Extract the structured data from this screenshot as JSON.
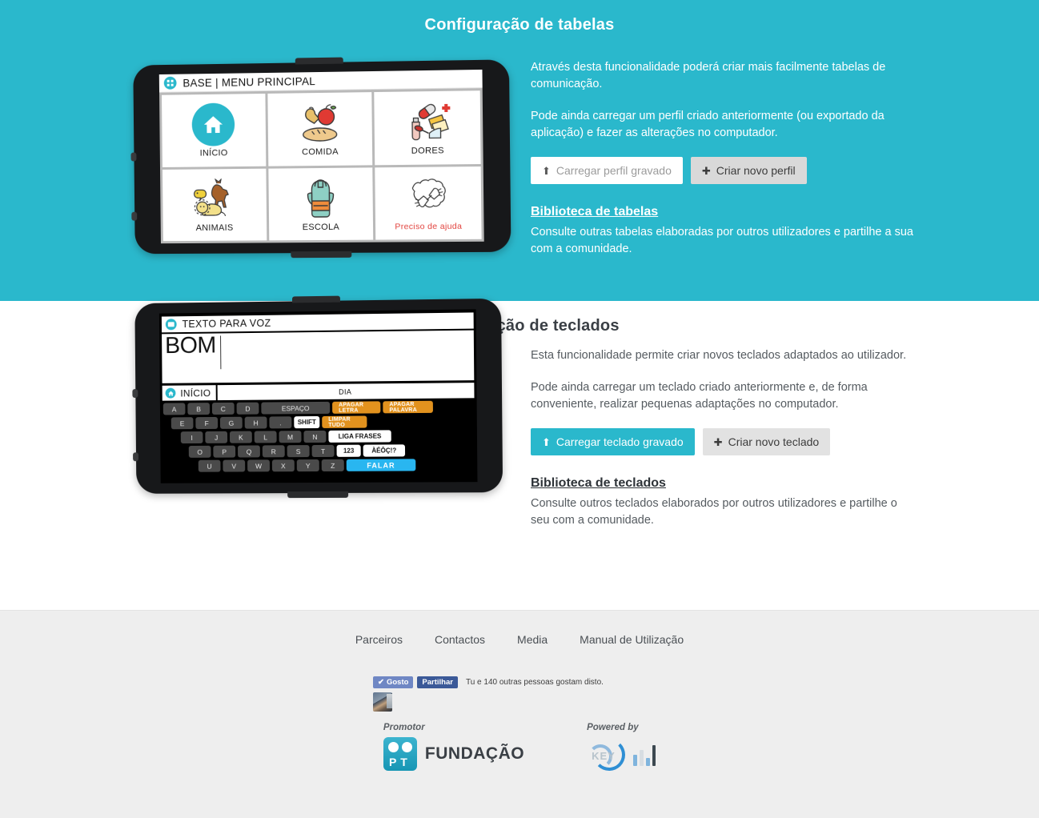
{
  "sections": {
    "tables": {
      "title": "Configuração de tabelas",
      "paragraphs": [
        "Através desta funcionalidade poderá criar mais facilmente tabelas de comunicação.",
        "Pode ainda carregar um perfil criado anteriormente (ou exportado da aplicação) e fazer as alterações no computador."
      ],
      "buttons": {
        "load": {
          "label": "Carregar perfil gravado",
          "icon": "upload-icon"
        },
        "create": {
          "label": "Criar novo perfil",
          "icon": "plus-icon"
        }
      },
      "library": {
        "title": "Biblioteca de tabelas",
        "description": "Consulte outras tabelas elaboradas por outros utilizadores e partilhe a sua com a comunidade."
      },
      "accent_color": "#2ab8cc"
    },
    "keyboards": {
      "title": "Configuração de teclados",
      "paragraphs": [
        "Esta funcionalidade permite criar novos teclados adaptados ao utilizador.",
        "Pode ainda carregar um teclado criado anteriormente e, de forma conveniente, realizar pequenas adaptações no computador."
      ],
      "buttons": {
        "load": {
          "label": "Carregar teclado gravado",
          "icon": "upload-icon"
        },
        "create": {
          "label": "Criar novo teclado",
          "icon": "plus-icon"
        }
      },
      "library": {
        "title": "Biblioteca de teclados",
        "description": "Consulte outros teclados elaborados por outros utilizadores e partilhe o seu com a comunidade."
      }
    }
  },
  "phone_tables": {
    "header_title": "BASE | MENU PRINCIPAL",
    "header_icon": "grid-icon",
    "tiles": [
      {
        "label": "INÍCIO",
        "art": "home-icon",
        "red": false
      },
      {
        "label": "COMIDA",
        "art": "food-icon",
        "red": false
      },
      {
        "label": "DORES",
        "art": "medicine-icon",
        "red": false
      },
      {
        "label": "ANIMAIS",
        "art": "animals-icon",
        "red": false
      },
      {
        "label": "ESCOLA",
        "art": "backpack-icon",
        "red": false
      },
      {
        "label": "Preciso de ajuda",
        "art": "helping-hands-icon",
        "red": true
      }
    ]
  },
  "phone_keyboard": {
    "header_title": "TEXTO PARA VOZ",
    "header_icon": "speech-bubble-icon",
    "typed_text": "BOM",
    "home_label": "INÍCIO",
    "home_icon": "home-icon",
    "suggestion": "DIA",
    "rows": [
      [
        {
          "label": "A",
          "type": "letter"
        },
        {
          "label": "B",
          "type": "letter"
        },
        {
          "label": "C",
          "type": "letter"
        },
        {
          "label": "D",
          "type": "letter"
        },
        {
          "label": "ESPAÇO",
          "type": "wide"
        },
        {
          "label": "APAGAR LETRA",
          "type": "orange"
        },
        {
          "label": "APAGAR PALAVRA",
          "type": "orange"
        }
      ],
      [
        {
          "label": "E",
          "type": "letter"
        },
        {
          "label": "F",
          "type": "letter"
        },
        {
          "label": "G",
          "type": "letter"
        },
        {
          "label": "H",
          "type": "letter"
        },
        {
          "label": ".",
          "type": "letter"
        },
        {
          "label": "SHIFT",
          "type": "white"
        },
        {
          "label": "LIMPAR TUDO",
          "type": "orange"
        }
      ],
      [
        {
          "label": "I",
          "type": "letter"
        },
        {
          "label": "J",
          "type": "letter"
        },
        {
          "label": "K",
          "type": "letter"
        },
        {
          "label": "L",
          "type": "letter"
        },
        {
          "label": "M",
          "type": "letter"
        },
        {
          "label": "N",
          "type": "letter"
        },
        {
          "label": "LIGA FRASES",
          "type": "white-wide"
        }
      ],
      [
        {
          "label": "O",
          "type": "letter"
        },
        {
          "label": "P",
          "type": "letter"
        },
        {
          "label": "Q",
          "type": "letter"
        },
        {
          "label": "R",
          "type": "letter"
        },
        {
          "label": "S",
          "type": "letter"
        },
        {
          "label": "T",
          "type": "letter"
        },
        {
          "label": "123",
          "type": "white"
        },
        {
          "label": "ÀÉÔÇ!?",
          "type": "white-wide"
        }
      ],
      [
        {
          "label": "U",
          "type": "letter"
        },
        {
          "label": "V",
          "type": "letter"
        },
        {
          "label": "W",
          "type": "letter"
        },
        {
          "label": "X",
          "type": "letter"
        },
        {
          "label": "Y",
          "type": "letter"
        },
        {
          "label": "Z",
          "type": "letter"
        },
        {
          "label": "FALAR",
          "type": "blue"
        }
      ]
    ]
  },
  "footer": {
    "nav": [
      {
        "label": "Parceiros"
      },
      {
        "label": "Contactos"
      },
      {
        "label": "Media"
      },
      {
        "label": "Manual de Utilização"
      }
    ],
    "facebook": {
      "like_label": "Gosto",
      "like_icon": "check-icon",
      "share_label": "Partilhar",
      "count_text": "Tu e 140 outras pessoas gostam disto."
    },
    "sponsors": [
      {
        "caption": "Promotor",
        "name": "FUNDAÇÃO",
        "mark": "PT"
      },
      {
        "caption": "Powered by",
        "name": "KEY",
        "mark": "smart-key"
      }
    ]
  }
}
